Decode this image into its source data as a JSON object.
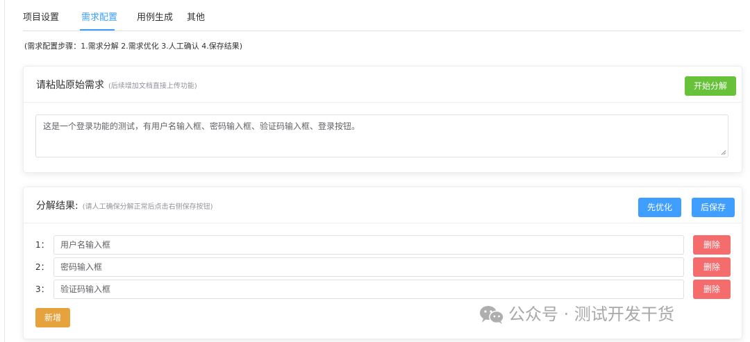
{
  "tabs": [
    {
      "label": "项目设置",
      "active": false
    },
    {
      "label": "需求配置",
      "active": true
    },
    {
      "label": "用例生成",
      "active": false
    },
    {
      "label": "其他",
      "active": false
    }
  ],
  "steps_text": "(需求配置步骤：1.需求分解 2.需求优化 3.人工确认 4.保存结果)",
  "paste_card": {
    "title": "请粘贴原始需求",
    "hint": "(后续增加文档直接上传功能)",
    "start_button": "开始分解",
    "textarea_value": "这是一个登录功能的测试，有用户名输入框、密码输入框、验证码输入框、登录按钮。"
  },
  "result_card": {
    "title": "分解结果:",
    "hint": "(请人工确保分解正常后点击右侧保存按钮)",
    "optimize_button": "先优化",
    "save_button": "后保存",
    "items": [
      {
        "index": "1：",
        "value": "用户名输入框",
        "delete_label": "删除"
      },
      {
        "index": "2：",
        "value": "密码输入框",
        "delete_label": "删除"
      },
      {
        "index": "3：",
        "value": "验证码输入框",
        "delete_label": "删除"
      }
    ],
    "add_button": "新增"
  },
  "watermark": {
    "text": "公众号 · 测试开发干货",
    "icon": "wechat-icon"
  },
  "colors": {
    "primary": "#409eff",
    "success": "#67c23a",
    "danger": "#f56c6c",
    "warning": "#e6a23c"
  }
}
